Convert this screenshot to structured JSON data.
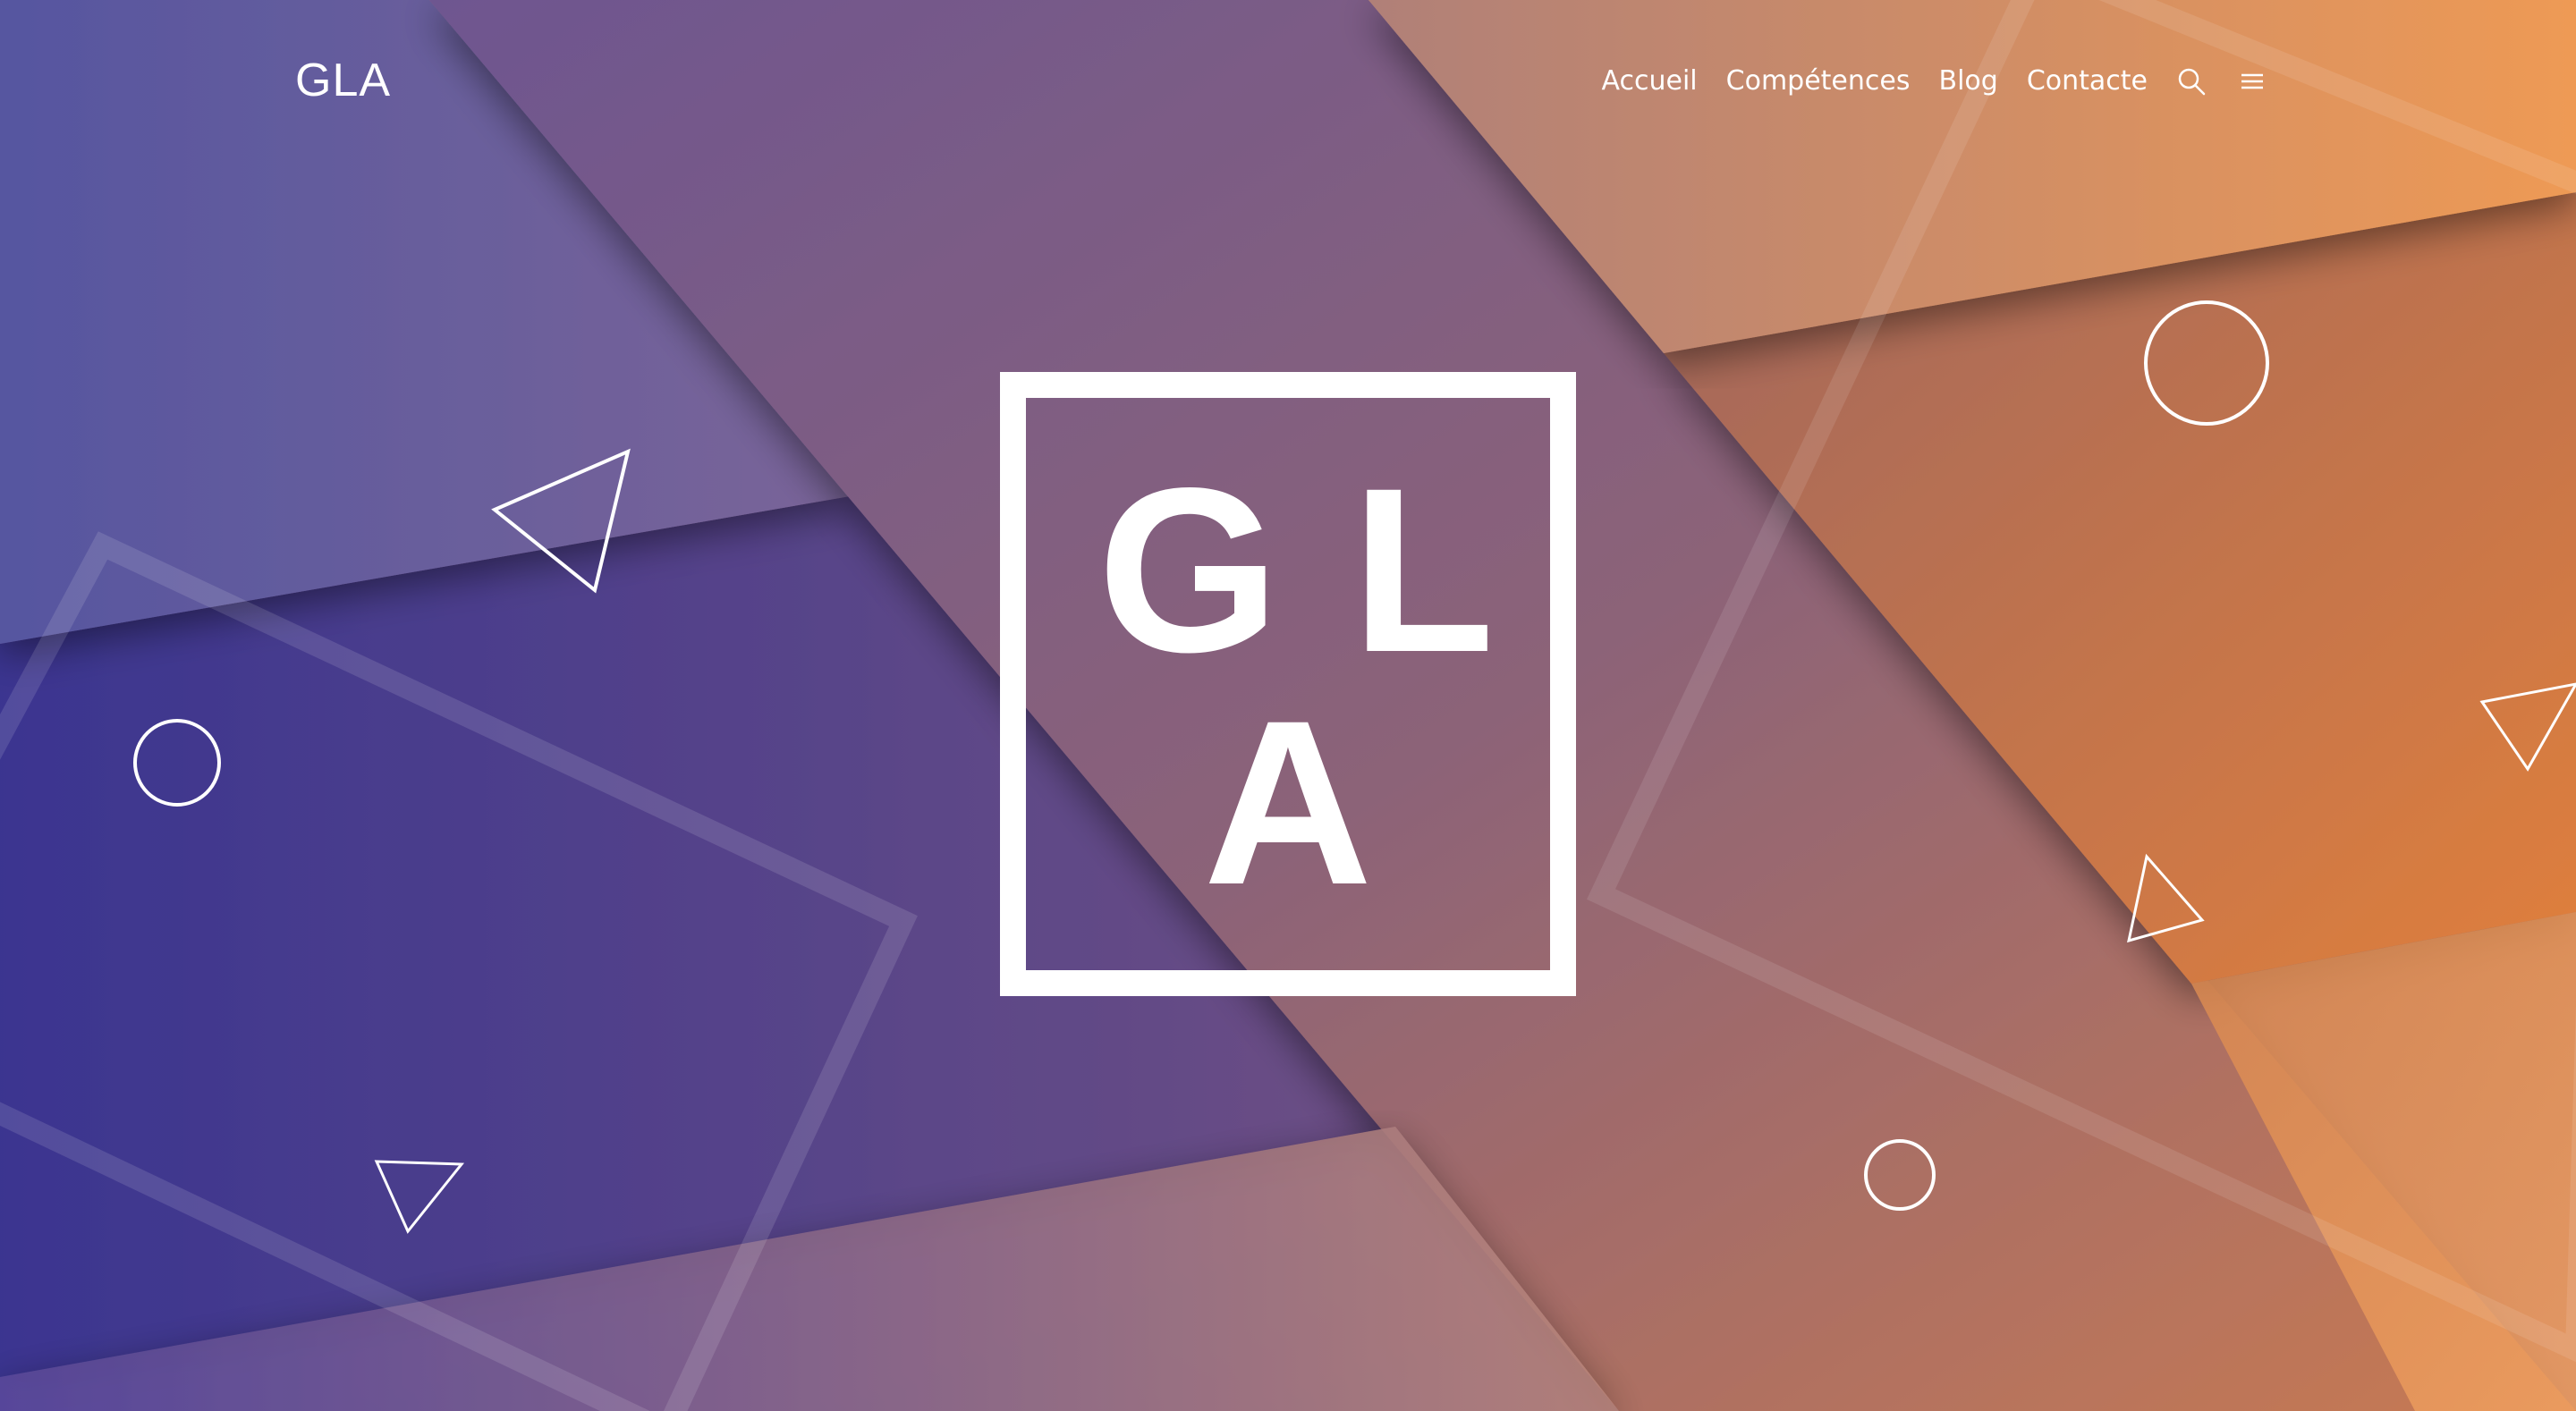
{
  "site": {
    "brand": "GLA"
  },
  "nav": {
    "items": [
      {
        "label": "Accueil"
      },
      {
        "label": "Compétences"
      },
      {
        "label": "Blog"
      },
      {
        "label": "Contacte"
      }
    ],
    "icons": [
      "search-icon",
      "menu-icon"
    ]
  },
  "hero": {
    "logo_line_1": "GL",
    "logo_line_2": "A"
  },
  "colors": {
    "gradient_start": "#3a3594",
    "gradient_mid": "#8a6080",
    "gradient_end": "#e8853e",
    "text": "#ffffff"
  }
}
